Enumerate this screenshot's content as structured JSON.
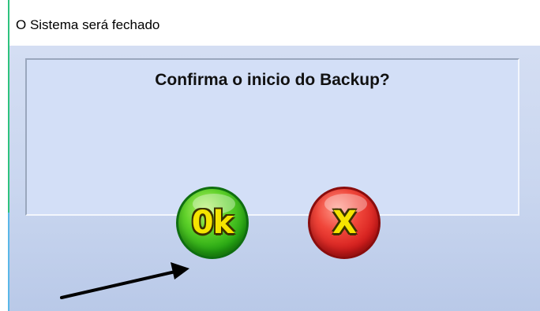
{
  "window": {
    "title": "O Sistema será fechado"
  },
  "dialog": {
    "message": "Confirma o inicio do Backup?",
    "ok_button": {
      "label": "0k",
      "color": "#23a512"
    },
    "cancel_button": {
      "label": "X",
      "color": "#d21b1b"
    }
  },
  "annotation": {
    "icon": "arrow-pointer-icon",
    "color": "#000000"
  }
}
